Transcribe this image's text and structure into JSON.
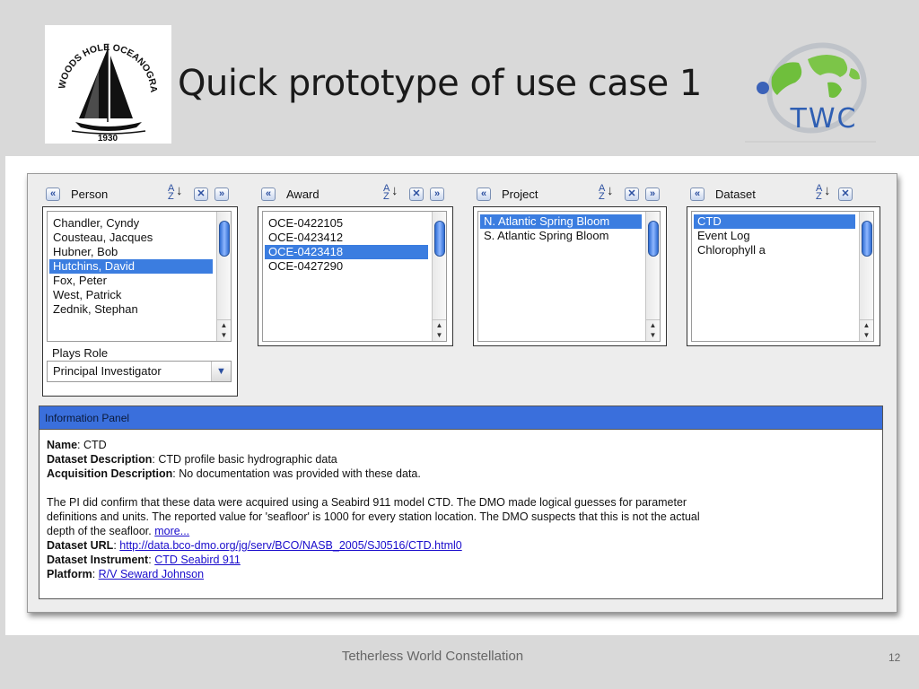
{
  "slide": {
    "title": "Quick prototype of use case 1",
    "footer": "Tetherless World Constellation",
    "page_number": "12",
    "logo_left_text": "WOODS HOLE OCEANOGRAPHIC INSTITUTION",
    "logo_left_year": "1930",
    "logo_right_text": "TWC"
  },
  "facets": {
    "person": {
      "title": "Person",
      "items": [
        "Chandler, Cyndy",
        "Cousteau, Jacques",
        "Hubner, Bob",
        "Hutchins, David",
        "Fox, Peter",
        "West, Patrick",
        "Zednik, Stephan"
      ],
      "selected": "Hutchins, David",
      "role_label": "Plays Role",
      "role_value": "Principal Investigator"
    },
    "award": {
      "title": "Award",
      "items": [
        "OCE-0422105",
        "OCE-0423412",
        "OCE-0423418",
        "OCE-0427290"
      ],
      "selected": "OCE-0423418"
    },
    "project": {
      "title": "Project",
      "items": [
        "N. Atlantic Spring Bloom",
        "S. Atlantic Spring Bloom"
      ],
      "selected": "N. Atlantic Spring Bloom"
    },
    "dataset": {
      "title": "Dataset",
      "items": [
        "CTD",
        "Event Log",
        "Chlorophyll a"
      ],
      "selected": "CTD"
    }
  },
  "header_buttons": {
    "prev": "«",
    "next": "»",
    "clear": "✕",
    "sort_az": "A Z",
    "sort_arrow": "↓"
  },
  "info_panel": {
    "header": "Information Panel",
    "name_label": "Name",
    "name_value": "CTD",
    "desc_label": "Dataset Description",
    "desc_value": "CTD profile basic hydrographic data",
    "acq_label": "Acquisition Description",
    "acq_value": "No documentation was provided with these data.",
    "para_line1": "The PI did confirm that these data were acquired using a Seabird 911 model CTD.  The DMO made logical guesses for parameter",
    "para_line2": "definitions and units.  The reported value for 'seafloor' is 1000 for every station location.  The DMO suspects that this is not the actual",
    "para_line3": "depth of the seafloor.",
    "more_link": "more...",
    "url_label": "Dataset URL",
    "url_value": "http://data.bco-dmo.org/jg/serv/BCO/NASB_2005/SJ0516/CTD.html0",
    "instrument_label": "Dataset Instrument",
    "instrument_value": "CTD Seabird 911",
    "platform_label": "Platform",
    "platform_value": "R/V Seward Johnson"
  },
  "colors": {
    "selection": "#3b7de0",
    "panel_header": "#3a6fdc",
    "link": "#1a0dcc"
  }
}
